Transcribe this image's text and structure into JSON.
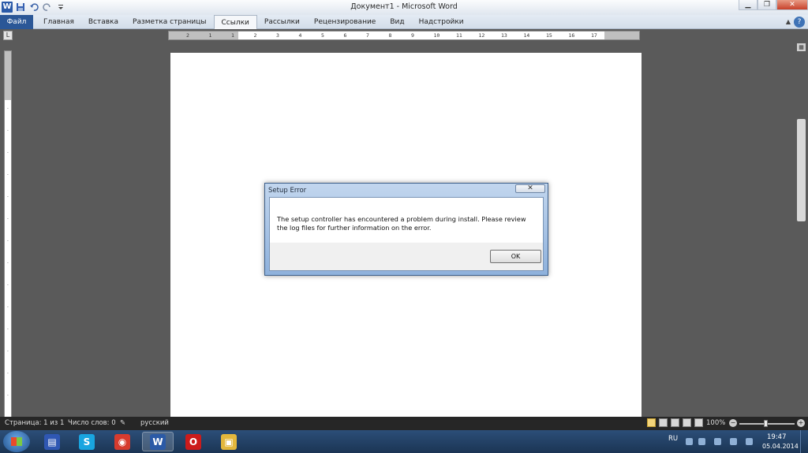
{
  "window": {
    "title": "Документ1 - Microsoft Word",
    "min": "▁",
    "max": "❐",
    "close": "✕"
  },
  "qat": {
    "app_icon": "W",
    "save_icon": "floppy-icon",
    "undo_icon": "undo-icon",
    "redo_icon": "redo-icon"
  },
  "ribbon": {
    "file_tab": "Файл",
    "tabs": [
      "Главная",
      "Вставка",
      "Разметка страницы",
      "Ссылки",
      "Рассылки",
      "Рецензирование",
      "Вид",
      "Надстройки"
    ],
    "active_tab": "Ссылки",
    "help": "?"
  },
  "ruler": {
    "corner": "L",
    "marks": [
      "2",
      "1",
      "1",
      "2",
      "3",
      "4",
      "5",
      "6",
      "7",
      "8",
      "9",
      "10",
      "11",
      "12",
      "13",
      "14",
      "15",
      "16",
      "17"
    ]
  },
  "dialog": {
    "title": "Setup Error",
    "close": "✕",
    "message": "The setup controller has encountered a problem during install.  Please review the log files for further information on the error.",
    "ok": "OK"
  },
  "statusbar": {
    "page": "Страница: 1 из 1",
    "words": "Число слов: 0",
    "language": "русский",
    "zoom": "100%",
    "zoom_minus": "−",
    "zoom_plus": "+"
  },
  "taskbar": {
    "apps": [
      {
        "name": "save",
        "glyph": "▤",
        "color": "#2f57b3"
      },
      {
        "name": "skype",
        "glyph": "S",
        "color": "#19a5e0"
      },
      {
        "name": "chrome",
        "glyph": "◉",
        "color": "#d63b2e"
      },
      {
        "name": "word",
        "glyph": "W",
        "color": "#2b5aa6"
      },
      {
        "name": "opera",
        "glyph": "O",
        "color": "#cc1b1b"
      },
      {
        "name": "explorer",
        "glyph": "▣",
        "color": "#e3b73c"
      }
    ],
    "lang": "RU",
    "time": "19:47",
    "date": "05.04.2014"
  }
}
